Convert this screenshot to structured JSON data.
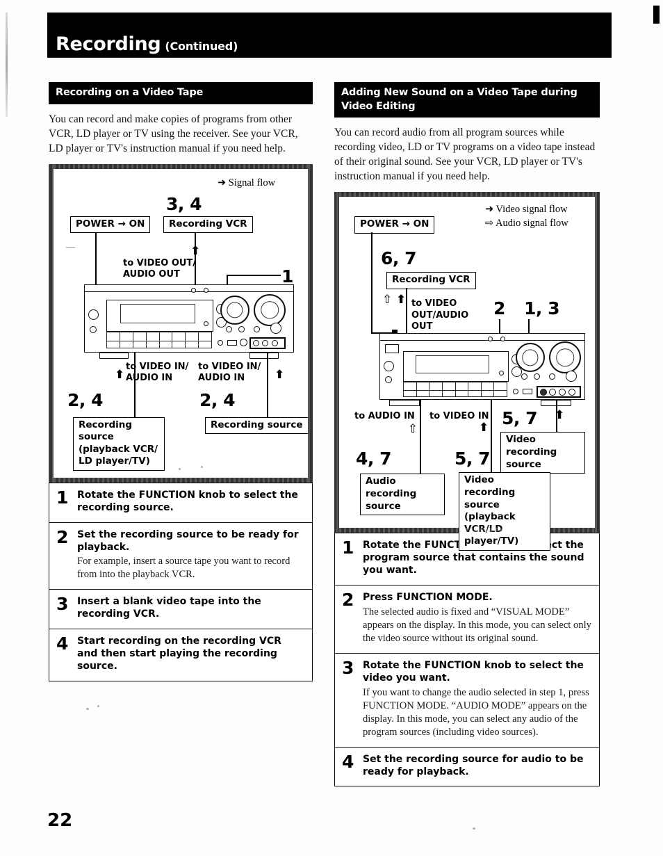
{
  "masthead": {
    "title": "Recording",
    "subtitle": "(Continued)"
  },
  "page_number": "22",
  "left_column": {
    "section_heading": "Recording on a Video Tape",
    "intro": "You can record and make copies of programs from other VCR, LD player or TV using the receiver.  See your VCR, LD player or TV's instruction manual if you need help.",
    "diagram": {
      "legend": [
        {
          "icon": "solid-arrow-icon",
          "label": "Signal flow"
        }
      ],
      "power_label": "POWER → ON",
      "recording_vcr_label": "Recording VCR",
      "recording_vcr_steps": "3, 4",
      "out_label": "to VIDEO OUT/\nAUDIO OUT",
      "knob_callout": "1",
      "in_label_left": "to VIDEO IN/\nAUDIO IN",
      "in_label_right": "to VIDEO IN/\nAUDIO IN",
      "source_steps_left": "2, 4",
      "source_steps_right": "2, 4",
      "source_box_left": "Recording source (playback VCR/ LD player/TV)",
      "source_box_right": "Recording source"
    },
    "steps": [
      {
        "number": "1",
        "title": "Rotate the FUNCTION knob to select the recording source.",
        "detail": ""
      },
      {
        "number": "2",
        "title": "Set the recording source to be ready for playback.",
        "detail": "For example, insert a source tape you want to record from into the playback VCR."
      },
      {
        "number": "3",
        "title": "Insert a blank video tape into the recording VCR.",
        "detail": ""
      },
      {
        "number": "4",
        "title": "Start recording on the recording VCR and then start playing the recording source.",
        "detail": ""
      }
    ]
  },
  "right_column": {
    "section_heading": "Adding New Sound on a Video Tape during Video Editing",
    "intro": "You can record audio from all program sources while recording video, LD or TV programs on a video tape instead of their original sound.  See your VCR, LD player or TV's instruction manual if you need help.",
    "diagram": {
      "legend": [
        {
          "icon": "solid-arrow-icon",
          "label": "Video signal flow"
        },
        {
          "icon": "hollow-arrow-icon",
          "label": "Audio signal flow"
        }
      ],
      "power_label": "POWER → ON",
      "recording_vcr_label": "Recording VCR",
      "recording_vcr_steps": "6, 7",
      "out_label": "to VIDEO OUT/AUDIO OUT",
      "button_callout": "2",
      "knob_callout": "1, 3",
      "audio_in_label": "to AUDIO IN",
      "video_in_label": "to VIDEO IN",
      "video_rec_steps_upper": "5, 7",
      "video_rec_box_upper": "Video recording source",
      "audio_steps": "4, 7",
      "audio_box": "Audio recording source",
      "video_steps": "5, 7",
      "video_box": "Video recording source (playback VCR/LD player/TV)"
    },
    "steps": [
      {
        "number": "1",
        "title": "Rotate the FUNCTION knob to select the program source that contains the sound you want.",
        "detail": ""
      },
      {
        "number": "2",
        "title": "Press FUNCTION MODE.",
        "detail": "The selected audio is fixed and “VISUAL MODE” appears on the display.  In this mode, you can select only the video source without its original sound."
      },
      {
        "number": "3",
        "title": "Rotate the FUNCTION knob to select the video you want.",
        "detail": "If you want to change the audio selected in step 1, press FUNCTION MODE.  “AUDIO MODE” appears on the display.  In this mode, you can select any audio of the program sources (including video sources)."
      },
      {
        "number": "4",
        "title": "Set the recording source for audio to be ready for playback.",
        "detail": ""
      }
    ]
  }
}
